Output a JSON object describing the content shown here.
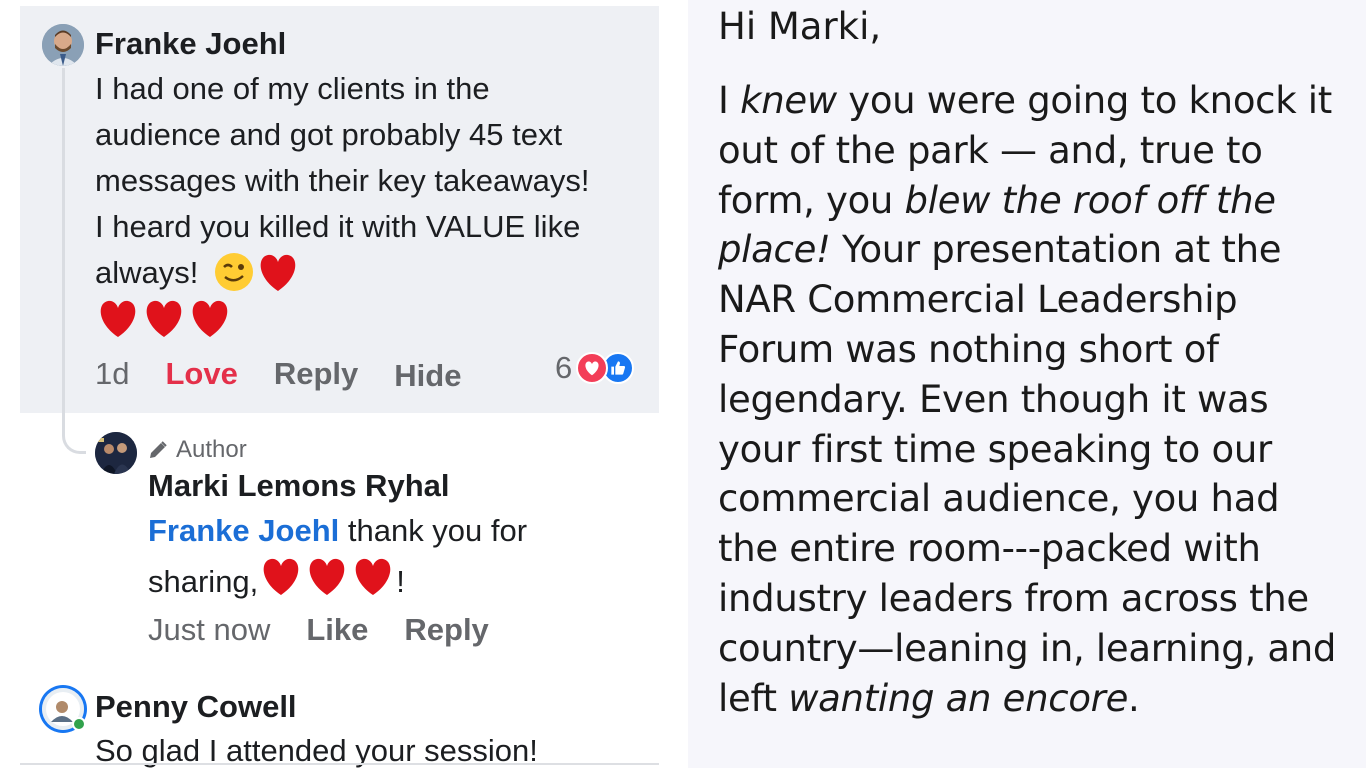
{
  "comments": {
    "franke": {
      "name": "Franke Joehl",
      "text": "I had one of my clients in the audience and got probably 45 text messages with their key takeaways! I heard you killed it with VALUE like always!",
      "time": "1d",
      "reaction_label": "Love",
      "reply_label": "Reply",
      "hide_label": "Hide",
      "reaction_count": "6"
    },
    "marki": {
      "badge": "Author",
      "name": "Marki Lemons Ryhal",
      "mention": "Franke Joehl",
      "text": " thank you for sharing,",
      "text_end": "!",
      "time": "Just now",
      "like_label": "Like",
      "reply_label": "Reply"
    },
    "penny": {
      "name": "Penny Cowell",
      "text": "So glad I attended your session!"
    }
  },
  "email": {
    "greeting": "Hi Marki,",
    "p1": "I ",
    "p1_em": "knew",
    "p2": " you were going to knock it out of the park — and, true to form, you ",
    "p2_em": "blew the roof off the place!",
    "p3": " Your presentation at the NAR Commercial Leadership Forum was nothing short of legendary. Even though it was your first time speaking to our commercial audience, you had the entire room---packed with industry leaders from across the country—leaning in, learning, and left ",
    "p3_em": "wanting an encore",
    "p4": "."
  },
  "colors": {
    "love_red": "#e4304a",
    "mention_blue": "#1b6ed6",
    "bubble_bg": "#eef0f4",
    "email_bg": "#f6f6fb"
  },
  "icons": [
    "pencil-icon",
    "heart-icon",
    "wink-emoji-icon",
    "love-reaction-icon",
    "like-reaction-icon"
  ]
}
